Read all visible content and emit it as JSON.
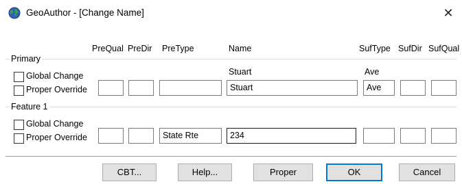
{
  "window": {
    "title": "GeoAuthor - [Change Name]",
    "close_glyph": "✕"
  },
  "columns": {
    "prequal": "PreQual",
    "predir": "PreDir",
    "pretype": "PreType",
    "name": "Name",
    "suftype": "SufType",
    "sufdir": "SufDir",
    "sufqual": "SufQual"
  },
  "primary": {
    "label": "Primary",
    "global_change": "Global Change",
    "proper_override": "Proper Override",
    "orig_name": "Stuart",
    "orig_suftype": "Ave",
    "fields": {
      "prequal": "",
      "predir": "",
      "pretype": "",
      "name": "Stuart",
      "suftype": "Ave",
      "sufdir": "",
      "sufqual": ""
    }
  },
  "feature1": {
    "label": "Feature 1",
    "global_change": "Global Change",
    "proper_override": "Proper Override",
    "fields": {
      "prequal": "",
      "predir": "",
      "pretype": "State Rte",
      "name": "234",
      "suftype": "",
      "sufdir": "",
      "sufqual": ""
    }
  },
  "buttons": {
    "cbt": "CBT...",
    "help": "Help...",
    "proper": "Proper",
    "ok": "OK",
    "cancel": "Cancel"
  },
  "colors": {
    "focus_border": "#0078d7",
    "button_face": "#e1e1e1"
  },
  "icons": {
    "app": "globe-icon",
    "close": "close-icon"
  }
}
